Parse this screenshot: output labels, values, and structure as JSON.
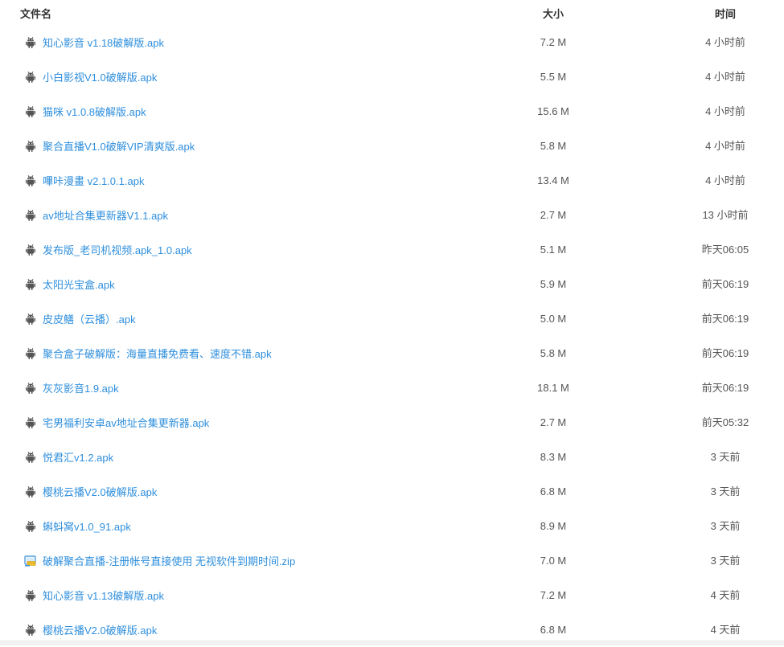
{
  "columns": {
    "name": "文件名",
    "size": "大小",
    "time": "时间"
  },
  "files": [
    {
      "name": "知心影音 v1.18破解版.apk",
      "size": "7.2 M",
      "time": "4 小时前",
      "icon": "android-icon"
    },
    {
      "name": "小白影视V1.0破解版.apk",
      "size": "5.5 M",
      "time": "4 小时前",
      "icon": "android-icon"
    },
    {
      "name": "猫咪 v1.0.8破解版.apk",
      "size": "15.6 M",
      "time": "4 小时前",
      "icon": "android-icon"
    },
    {
      "name": "聚合直播V1.0破解VIP清爽版.apk",
      "size": "5.8 M",
      "time": "4 小时前",
      "icon": "android-icon"
    },
    {
      "name": "嗶咔漫畫 v2.1.0.1.apk",
      "size": "13.4 M",
      "time": "4 小时前",
      "icon": "android-icon"
    },
    {
      "name": "av地址合集更新器V1.1.apk",
      "size": "2.7 M",
      "time": "13 小时前",
      "icon": "android-icon"
    },
    {
      "name": "发布版_老司机视频.apk_1.0.apk",
      "size": "5.1 M",
      "time": "昨天06:05",
      "icon": "android-icon"
    },
    {
      "name": "太阳光宝盒.apk",
      "size": "5.9 M",
      "time": "前天06:19",
      "icon": "android-icon"
    },
    {
      "name": "皮皮鳝（云播）.apk",
      "size": "5.0 M",
      "time": "前天06:19",
      "icon": "android-icon"
    },
    {
      "name": "聚合盒子破解版：海量直播免费看、速度不错.apk",
      "size": "5.8 M",
      "time": "前天06:19",
      "icon": "android-icon"
    },
    {
      "name": "灰灰影音1.9.apk",
      "size": "18.1 M",
      "time": "前天06:19",
      "icon": "android-icon"
    },
    {
      "name": "宅男福利安卓av地址合集更新器.apk",
      "size": "2.7 M",
      "time": "前天05:32",
      "icon": "android-icon"
    },
    {
      "name": "悦君汇v1.2.apk",
      "size": "8.3 M",
      "time": "3 天前",
      "icon": "android-icon"
    },
    {
      "name": "樱桃云播V2.0破解版.apk",
      "size": "6.8 M",
      "time": "3 天前",
      "icon": "android-icon"
    },
    {
      "name": "蝌蚪窝v1.0_91.apk",
      "size": "8.9 M",
      "time": "3 天前",
      "icon": "android-icon"
    },
    {
      "name": "破解聚合直播-注册帐号直接使用 无视软件到期时间.zip",
      "size": "7.0 M",
      "time": "3 天前",
      "icon": "zip-file-icon"
    },
    {
      "name": "知心影音 v1.13破解版.apk",
      "size": "7.2 M",
      "time": "4 天前",
      "icon": "android-icon"
    },
    {
      "name": "樱桃云播V2.0破解版.apk",
      "size": "6.8 M",
      "time": "4 天前",
      "icon": "android-icon"
    }
  ],
  "colors": {
    "link": "#2f8fdd",
    "android_icon": "#555555",
    "zip_icon_blue": "#3b8fd8",
    "zip_icon_yellow": "#f2c230"
  }
}
